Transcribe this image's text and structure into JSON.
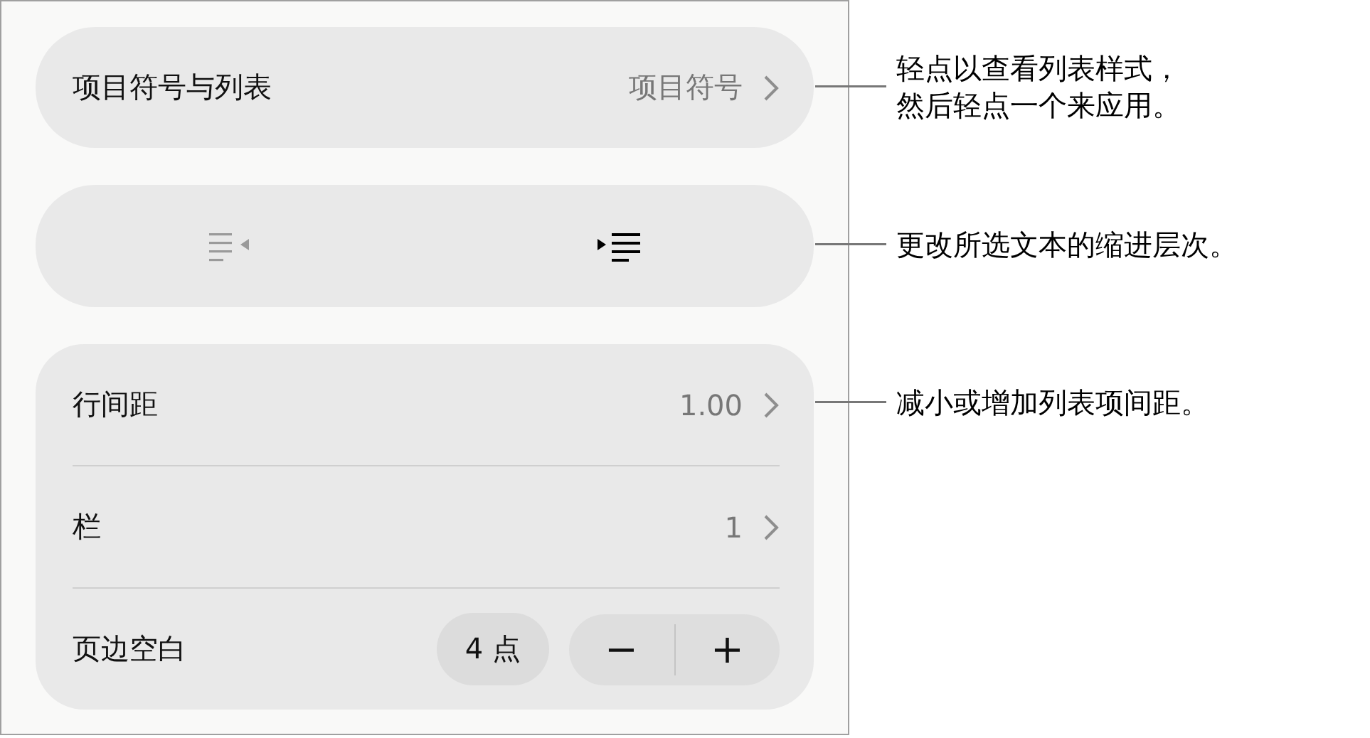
{
  "panel": {
    "groups": [
      {
        "kind": "nav",
        "rows": [
          {
            "kind": "nav",
            "label": "项目符号与列表",
            "value": "项目符号"
          }
        ]
      },
      {
        "kind": "indent",
        "buttons": [
          {
            "kind": "outdent",
            "disabled": true
          },
          {
            "kind": "indent",
            "disabled": false
          }
        ]
      },
      {
        "kind": "list",
        "rows": [
          {
            "kind": "nav",
            "label": "行间距",
            "value": "1.00"
          },
          {
            "kind": "nav",
            "label": "栏",
            "value": "1"
          },
          {
            "kind": "stepper",
            "label": "页边空白",
            "value": "4 点",
            "minus": "−",
            "plus": "+"
          }
        ]
      }
    ]
  },
  "callouts": [
    {
      "lines": [
        "轻点以查看列表样式，",
        "然后轻点一个来应用。"
      ]
    },
    {
      "lines": [
        "更改所选文本的缩进层次。"
      ]
    },
    {
      "lines": [
        "减小或增加列表项间距。"
      ]
    }
  ]
}
